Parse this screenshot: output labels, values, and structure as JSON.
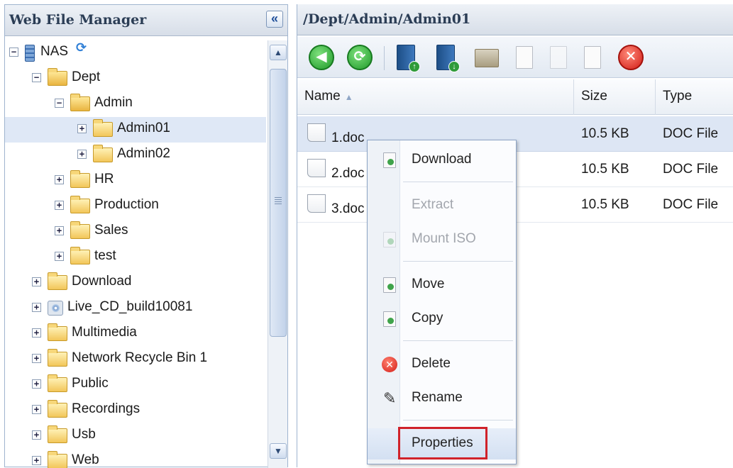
{
  "left_panel": {
    "title": "Web File Manager",
    "collapse_icon": "«",
    "tree": [
      {
        "label": "NAS",
        "level": 0,
        "toggle": "minus",
        "icon": "nas"
      },
      {
        "label": "Dept",
        "level": 1,
        "toggle": "minus",
        "icon": "folder-open"
      },
      {
        "label": "Admin",
        "level": 2,
        "toggle": "minus",
        "icon": "folder-open"
      },
      {
        "label": "Admin01",
        "level": 3,
        "toggle": "plus",
        "icon": "folder",
        "selected": true
      },
      {
        "label": "Admin02",
        "level": 3,
        "toggle": "plus",
        "icon": "folder"
      },
      {
        "label": "HR",
        "level": 2,
        "toggle": "plus",
        "icon": "folder"
      },
      {
        "label": "Production",
        "level": 2,
        "toggle": "plus",
        "icon": "folder"
      },
      {
        "label": "Sales",
        "level": 2,
        "toggle": "plus",
        "icon": "folder"
      },
      {
        "label": "test",
        "level": 2,
        "toggle": "plus",
        "icon": "folder"
      },
      {
        "label": "Download",
        "level": 1,
        "toggle": "plus",
        "icon": "folder"
      },
      {
        "label": "Live_CD_build10081",
        "level": 1,
        "toggle": "plus",
        "icon": "cd"
      },
      {
        "label": "Multimedia",
        "level": 1,
        "toggle": "plus",
        "icon": "folder"
      },
      {
        "label": "Network Recycle Bin 1",
        "level": 1,
        "toggle": "plus",
        "icon": "folder"
      },
      {
        "label": "Public",
        "level": 1,
        "toggle": "plus",
        "icon": "folder"
      },
      {
        "label": "Recordings",
        "level": 1,
        "toggle": "plus",
        "icon": "folder"
      },
      {
        "label": "Usb",
        "level": 1,
        "toggle": "plus",
        "icon": "folder"
      },
      {
        "label": "Web",
        "level": 1,
        "toggle": "plus",
        "icon": "folder"
      }
    ]
  },
  "right_panel": {
    "path": "/Dept/Admin/Admin01",
    "toolbar_icons": [
      "back-icon",
      "refresh-icon",
      "upload-icon",
      "download-icon",
      "new-folder-icon",
      "rename-icon",
      "copy-icon",
      "move-icon",
      "delete-icon"
    ],
    "columns": {
      "name": "Name",
      "size": "Size",
      "type": "Type"
    },
    "sort_indicator": "▲",
    "files": [
      {
        "name": "1.doc",
        "size": "10.5 KB",
        "type": "DOC File"
      },
      {
        "name": "2.doc",
        "size": "10.5 KB",
        "type": "DOC File"
      },
      {
        "name": "3.doc",
        "size": "10.5 KB",
        "type": "DOC File"
      }
    ]
  },
  "context_menu": {
    "download": "Download",
    "extract": "Extract",
    "mount_iso": "Mount ISO",
    "move": "Move",
    "copy": "Copy",
    "delete": "Delete",
    "rename": "Rename",
    "properties": "Properties"
  },
  "colors": {
    "highlight": "#d0222a",
    "selected_row": "#dde6f4",
    "header_text": "#2b3d55"
  }
}
